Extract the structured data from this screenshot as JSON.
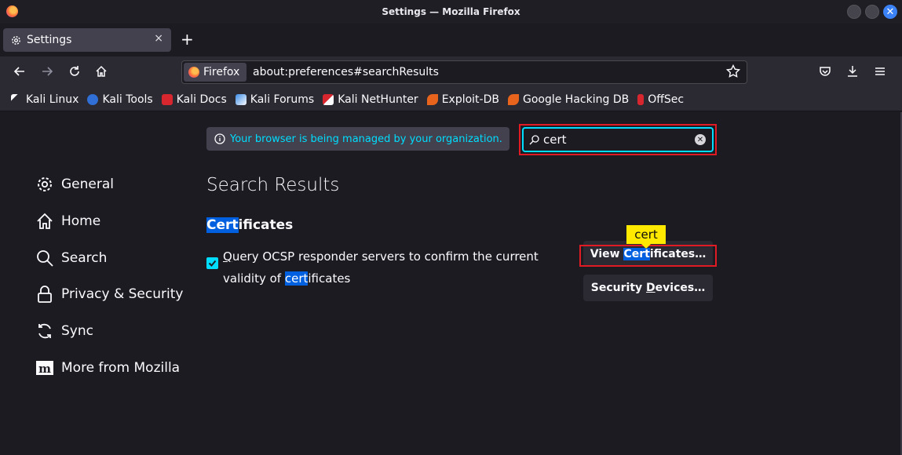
{
  "window": {
    "title": "Settings — Mozilla Firefox"
  },
  "tab": {
    "label": "Settings",
    "close": "×"
  },
  "newtab": "+",
  "urlbar": {
    "identity": "Firefox",
    "url": "about:preferences#searchResults"
  },
  "bookmarks": [
    {
      "label": "Kali Linux",
      "icon": "kali-dragon-icon"
    },
    {
      "label": "Kali Tools",
      "icon": "kali-tools-icon"
    },
    {
      "label": "Kali Docs",
      "icon": "kali-docs-icon"
    },
    {
      "label": "Kali Forums",
      "icon": "kali-forums-icon"
    },
    {
      "label": "Kali NetHunter",
      "icon": "nethunter-icon"
    },
    {
      "label": "Exploit-DB",
      "icon": "exploit-db-icon"
    },
    {
      "label": "Google Hacking DB",
      "icon": "ghdb-icon"
    },
    {
      "label": "OffSec",
      "icon": "offsec-icon"
    }
  ],
  "managed_notice": "Your browser is being managed by your organization.",
  "search": {
    "value": "cert"
  },
  "sidebar": {
    "items": [
      {
        "label": "General",
        "icon": "gear-icon"
      },
      {
        "label": "Home",
        "icon": "home-icon"
      },
      {
        "label": "Search",
        "icon": "search-icon"
      },
      {
        "label": "Privacy & Security",
        "icon": "lock-icon"
      },
      {
        "label": "Sync",
        "icon": "sync-icon"
      },
      {
        "label": "More from Mozilla",
        "icon": "mozilla-icon"
      }
    ]
  },
  "results": {
    "title": "Search Results",
    "heading_hl": "Cert",
    "heading_rest": "ificates",
    "ocsp_q": "Q",
    "ocsp_text": "uery OCSP responder servers to confirm the current validity of ",
    "ocsp_hl": "cert",
    "ocsp_rest": "ificates",
    "tooltip": "cert",
    "view_certs_pre": "View ",
    "view_certs_hl": "Cert",
    "view_certs_rest": "ificates…",
    "sec_devices_pre": "Security ",
    "sec_devices_u": "D",
    "sec_devices_rest": "evices…"
  }
}
